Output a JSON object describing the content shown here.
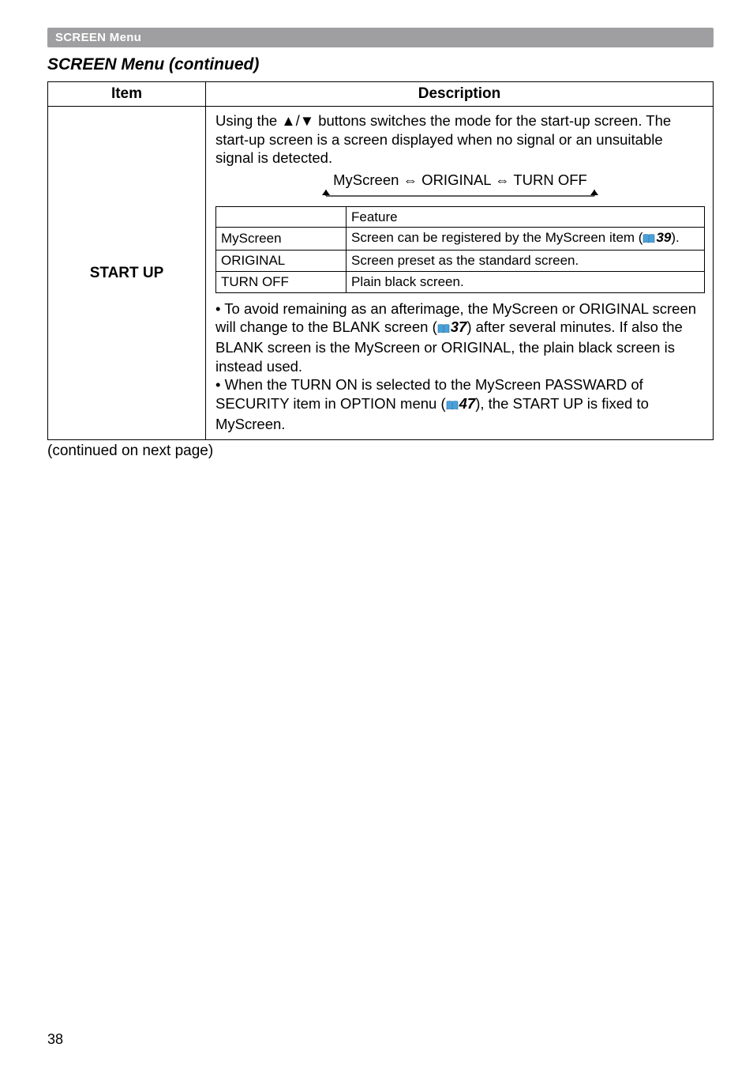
{
  "header": {
    "bar": "SCREEN Menu",
    "title": "SCREEN Menu (continued)"
  },
  "table": {
    "head": {
      "item": "Item",
      "desc": "Description"
    },
    "row": {
      "item": "START UP",
      "intro": "Using the ▲/▼ buttons switches the mode for the start-up screen. The start-up screen is a screen displayed when no signal or an unsuitable signal is detected.",
      "modeLine": "MyScreen ⇔ ORIGINAL ⇔ TURN OFF",
      "inner": {
        "featureHead": "Feature",
        "rows": [
          {
            "name": "MyScreen",
            "feat_a": "Screen can be registered by the MyScreen item (",
            "feat_ref": "39",
            "feat_b": ")."
          },
          {
            "name": "ORIGINAL",
            "feat": "Screen preset as the standard screen."
          },
          {
            "name": "TURN OFF",
            "feat": "Plain black screen."
          }
        ]
      },
      "note1a": "• To avoid remaining as an afterimage, the MyScreen or ORIGINAL screen will change to the BLANK screen (",
      "note1ref": "37",
      "note1b": ") after several minutes. If also the BLANK screen is the MyScreen or ORIGINAL, the plain black screen is instead used.",
      "note2a": "• When the TURN ON is selected to the MyScreen PASSWARD of SECURITY item in OPTION menu (",
      "note2ref": "47",
      "note2b": "), the START UP is fixed to MyScreen."
    }
  },
  "continued": "(continued on next page)",
  "pageNum": "38"
}
